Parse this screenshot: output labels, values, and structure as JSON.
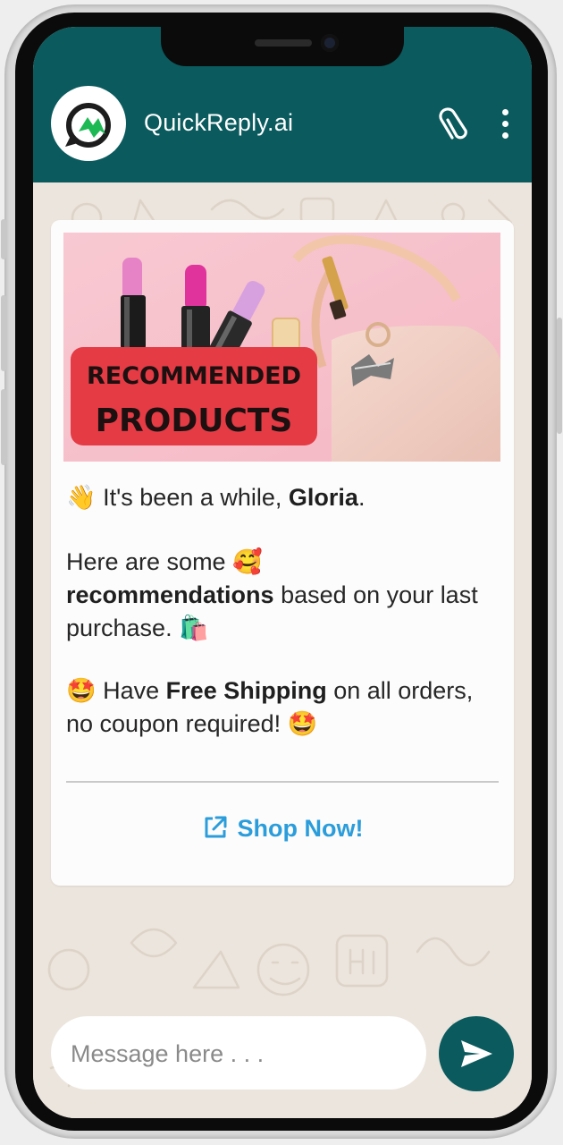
{
  "header": {
    "app_name": "QuickReply.ai"
  },
  "icons": {
    "avatar": "quickreply-logo-icon",
    "attach": "paperclip-icon",
    "menu": "more-vertical-icon",
    "external_link": "external-link-icon",
    "send": "send-icon"
  },
  "banner": {
    "line1": "RECOMMENDED",
    "line2": "PRODUCTS"
  },
  "message": {
    "p1_emoji": "👋",
    "p1_text": " It's been a while, ",
    "p1_name": "Gloria",
    "p1_end": ".",
    "p2_text": "Here are some ",
    "p2_emoji": "🥰",
    "p2_bold": "recommendations",
    "p2_rest": " based on your last purchase. ",
    "p2_emoji_end": "🛍️",
    "p3_emoji": "🤩",
    "p3_text": " Have ",
    "p3_bold": "Free Shipping",
    "p3_rest": " on all orders, no coupon required! ",
    "p3_emoji_end": "🤩"
  },
  "cta": {
    "label": "Shop Now!"
  },
  "composer": {
    "placeholder": "Message here . . ."
  },
  "colors": {
    "header": "#0a5a5e",
    "chat_background": "#ece5dd",
    "link": "#2b9ddb",
    "banner_label": "#e43b45",
    "banner_background": "#f7c6cf"
  }
}
